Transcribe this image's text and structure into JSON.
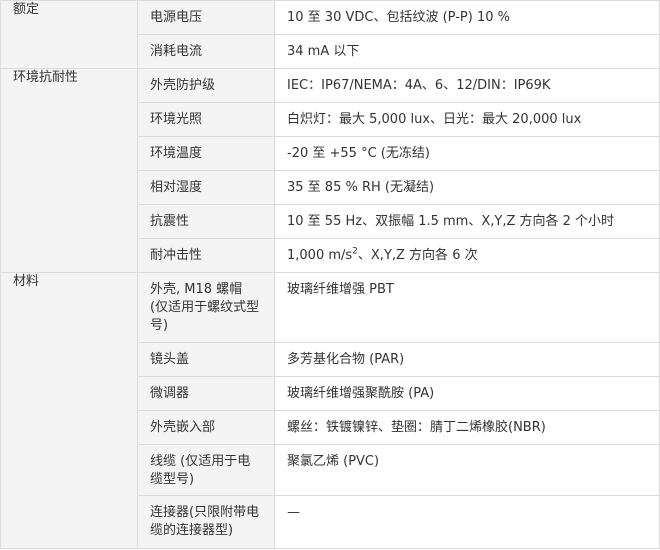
{
  "rows": [
    {
      "category": "额定",
      "name": "电源电压",
      "value": "10 至 30 VDC、包括纹波 (P-P) 10 %"
    },
    {
      "name": "消耗电流",
      "value": "34 mA 以下"
    },
    {
      "category": "环境抗耐性",
      "name": "外壳防护级",
      "value": "IEC：IP67/NEMA：4A、6、12/DIN：IP69K"
    },
    {
      "name": "环境光照",
      "value": "白炽灯：最大 5,000 lux、日光：最大 20,000 lux"
    },
    {
      "name": "环境温度",
      "value": "-20 至 +55 °C (无冻结)"
    },
    {
      "name": "相对湿度",
      "value": "35 至 85 % RH (无凝结)"
    },
    {
      "name": "抗震性",
      "value": "10 至 55 Hz、双振幅 1.5 mm、X,Y,Z 方向各 2 个小时"
    },
    {
      "name": "耐冲击性",
      "value_pre": "1,000 m/s",
      "value_sup": "2",
      "value_post": "、X,Y,Z 方向各 6 次"
    },
    {
      "category": "材料",
      "name": "外壳, M18 螺帽 (仅适用于螺纹式型号)",
      "value": "玻璃纤维增强 PBT"
    },
    {
      "name": "镜头盖",
      "value": "多芳基化合物 (PAR)"
    },
    {
      "name": "微调器",
      "value": "玻璃纤维增强聚酰胺 (PA)"
    },
    {
      "name": "外壳嵌入部",
      "value": "螺丝：铁镀镍锌、垫圈：腈丁二烯橡胶(NBR)"
    },
    {
      "name": "线缆 (仅适用于电缆型号)",
      "value": "聚氯乙烯 (PVC)"
    },
    {
      "name": "连接器(只限附带电缆的连接器型)",
      "value": "—"
    }
  ]
}
